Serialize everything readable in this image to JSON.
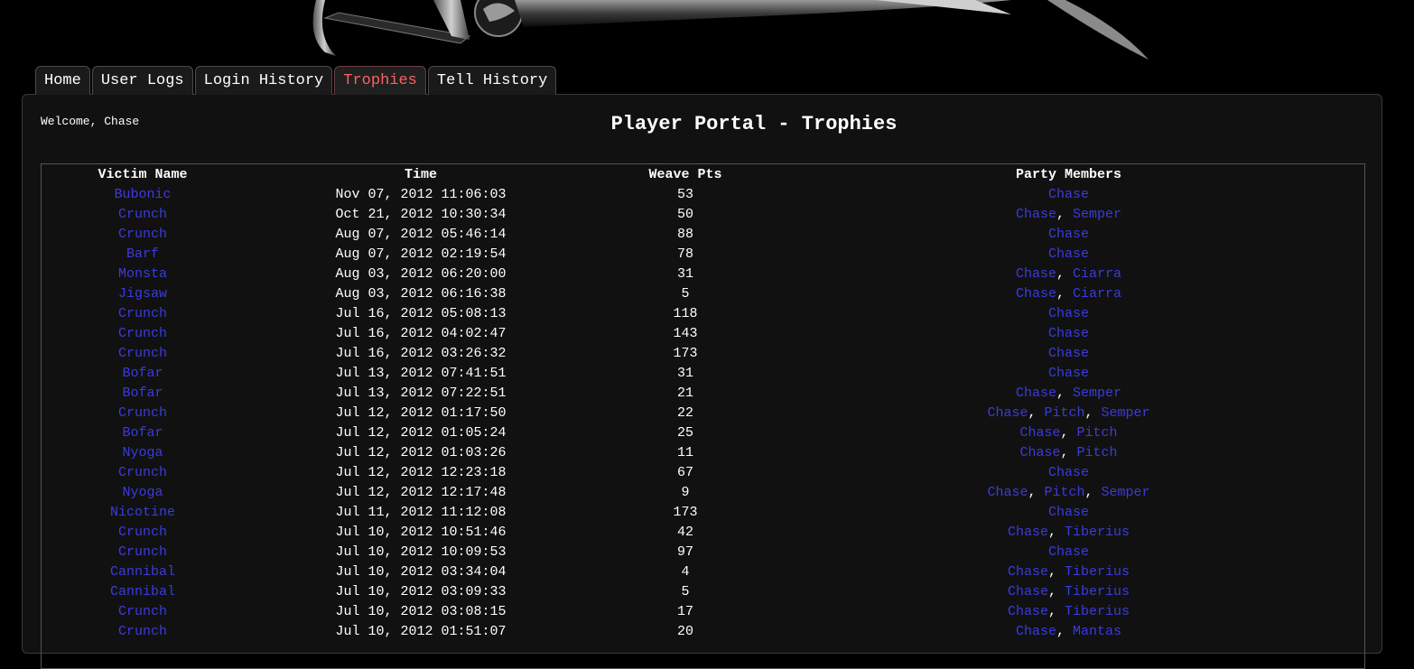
{
  "tabs": [
    {
      "label": "Home",
      "active": false
    },
    {
      "label": "User Logs",
      "active": false
    },
    {
      "label": "Login History",
      "active": false
    },
    {
      "label": "Trophies",
      "active": true
    },
    {
      "label": "Tell History",
      "active": false
    }
  ],
  "welcome": "Welcome, Chase",
  "title": "Player Portal - Trophies",
  "table": {
    "headers": [
      "Victim Name",
      "Time",
      "Weave Pts",
      "Party Members"
    ],
    "rows": [
      {
        "victim": "Bubonic",
        "time": "Nov 07, 2012 11:06:03",
        "pts": "53",
        "party": [
          "Chase"
        ]
      },
      {
        "victim": "Crunch",
        "time": "Oct 21, 2012 10:30:34",
        "pts": "50",
        "party": [
          "Chase",
          "Semper"
        ]
      },
      {
        "victim": "Crunch",
        "time": "Aug 07, 2012 05:46:14",
        "pts": "88",
        "party": [
          "Chase"
        ]
      },
      {
        "victim": "Barf",
        "time": "Aug 07, 2012 02:19:54",
        "pts": "78",
        "party": [
          "Chase"
        ]
      },
      {
        "victim": "Monsta",
        "time": "Aug 03, 2012 06:20:00",
        "pts": "31",
        "party": [
          "Chase",
          "Ciarra"
        ]
      },
      {
        "victim": "Jigsaw",
        "time": "Aug 03, 2012 06:16:38",
        "pts": "5",
        "party": [
          "Chase",
          "Ciarra"
        ]
      },
      {
        "victim": "Crunch",
        "time": "Jul 16, 2012 05:08:13",
        "pts": "118",
        "party": [
          "Chase"
        ]
      },
      {
        "victim": "Crunch",
        "time": "Jul 16, 2012 04:02:47",
        "pts": "143",
        "party": [
          "Chase"
        ]
      },
      {
        "victim": "Crunch",
        "time": "Jul 16, 2012 03:26:32",
        "pts": "173",
        "party": [
          "Chase"
        ]
      },
      {
        "victim": "Bofar",
        "time": "Jul 13, 2012 07:41:51",
        "pts": "31",
        "party": [
          "Chase"
        ]
      },
      {
        "victim": "Bofar",
        "time": "Jul 13, 2012 07:22:51",
        "pts": "21",
        "party": [
          "Chase",
          "Semper"
        ]
      },
      {
        "victim": "Crunch",
        "time": "Jul 12, 2012 01:17:50",
        "pts": "22",
        "party": [
          "Chase",
          "Pitch",
          "Semper"
        ]
      },
      {
        "victim": "Bofar",
        "time": "Jul 12, 2012 01:05:24",
        "pts": "25",
        "party": [
          "Chase",
          "Pitch"
        ]
      },
      {
        "victim": "Nyoga",
        "time": "Jul 12, 2012 01:03:26",
        "pts": "11",
        "party": [
          "Chase",
          "Pitch"
        ]
      },
      {
        "victim": "Crunch",
        "time": "Jul 12, 2012 12:23:18",
        "pts": "67",
        "party": [
          "Chase"
        ]
      },
      {
        "victim": "Nyoga",
        "time": "Jul 12, 2012 12:17:48",
        "pts": "9",
        "party": [
          "Chase",
          "Pitch",
          "Semper"
        ]
      },
      {
        "victim": "Nicotine",
        "time": "Jul 11, 2012 11:12:08",
        "pts": "173",
        "party": [
          "Chase"
        ]
      },
      {
        "victim": "Crunch",
        "time": "Jul 10, 2012 10:51:46",
        "pts": "42",
        "party": [
          "Chase",
          "Tiberius"
        ]
      },
      {
        "victim": "Crunch",
        "time": "Jul 10, 2012 10:09:53",
        "pts": "97",
        "party": [
          "Chase"
        ]
      },
      {
        "victim": "Cannibal",
        "time": "Jul 10, 2012 03:34:04",
        "pts": "4",
        "party": [
          "Chase",
          "Tiberius"
        ]
      },
      {
        "victim": "Cannibal",
        "time": "Jul 10, 2012 03:09:33",
        "pts": "5",
        "party": [
          "Chase",
          "Tiberius"
        ]
      },
      {
        "victim": "Crunch",
        "time": "Jul 10, 2012 03:08:15",
        "pts": "17",
        "party": [
          "Chase",
          "Tiberius"
        ]
      },
      {
        "victim": "Crunch",
        "time": "Jul 10, 2012 01:51:07",
        "pts": "20",
        "party": [
          "Chase",
          "Mantas"
        ]
      }
    ]
  },
  "colors": {
    "link": "#3b3bde",
    "active_tab": "#ff6060",
    "panel_bg": "#111111"
  }
}
